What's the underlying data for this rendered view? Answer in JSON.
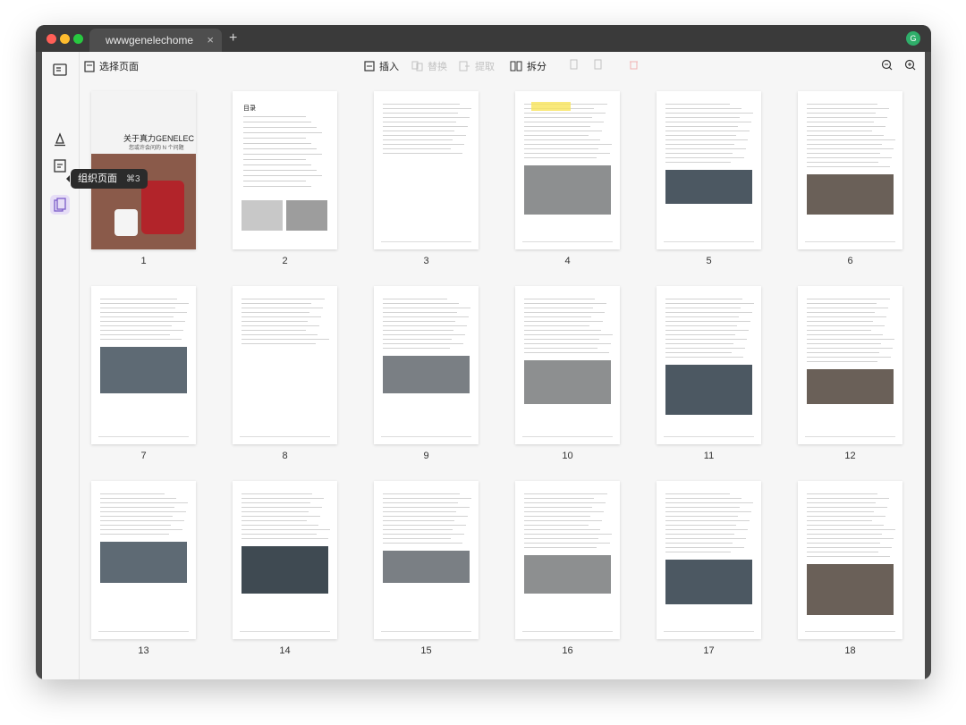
{
  "browser": {
    "tab_title": "wwwgenelechome",
    "close_glyph": "×",
    "new_tab_glyph": "+",
    "avatar_letter": "G"
  },
  "toolbar": {
    "select_pages": "选择页面",
    "insert": "插入",
    "replace": "替换",
    "extract": "提取",
    "split": "拆分"
  },
  "sidebar": {
    "tooltip_label": "组织页面",
    "tooltip_shortcut": "⌘3"
  },
  "cover": {
    "title": "关于真力GENELEC",
    "subtitle": "您或许会问的 N 个问题"
  },
  "toc": {
    "title": "目录"
  },
  "pages": [
    "1",
    "2",
    "3",
    "4",
    "5",
    "6",
    "7",
    "8",
    "9",
    "10",
    "11",
    "12",
    "13",
    "14",
    "15",
    "16",
    "17",
    "18"
  ],
  "colors": {
    "accent": "#7b5cc9",
    "window": "#4a4a4a",
    "red": "#ff5f57",
    "yellow": "#febc2e",
    "green": "#28c840"
  },
  "icons": [
    "layout-icon",
    "annotate-icon",
    "edit-icon",
    "organize-pages-icon",
    "select-pages-icon",
    "insert-icon",
    "replace-icon",
    "extract-icon",
    "split-icon",
    "rotate-left-icon",
    "rotate-right-icon",
    "delete-icon",
    "zoom-out-icon",
    "zoom-in-icon"
  ]
}
